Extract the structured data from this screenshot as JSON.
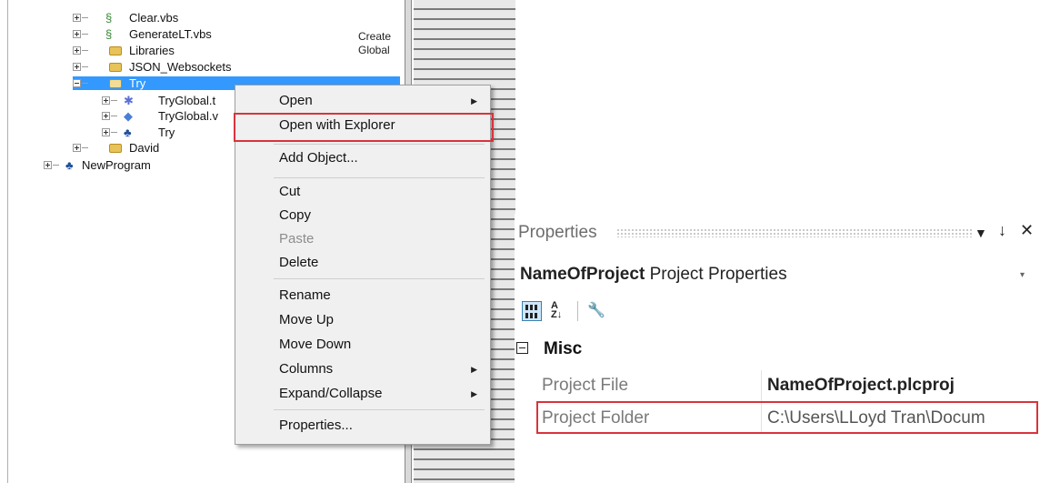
{
  "tree": {
    "items": [
      {
        "label": "Clear.vbs",
        "icon": "script-icon"
      },
      {
        "label": "GenerateLT.vbs",
        "icon": "script-icon"
      },
      {
        "label": "Libraries",
        "icon": "folder-icon"
      },
      {
        "label": "JSON_Websockets",
        "icon": "folder-icon"
      },
      {
        "label": "Try",
        "icon": "folder-icon"
      },
      {
        "label": "TryGlobal.t",
        "icon": "global-tag-icon"
      },
      {
        "label": "TryGlobal.v",
        "icon": "global-script-icon"
      },
      {
        "label": "Try",
        "icon": "program-icon"
      },
      {
        "label": "David",
        "icon": "folder-icon"
      },
      {
        "label": "NewProgram",
        "icon": "program-icon"
      }
    ],
    "descriptions": [
      "Create",
      "Global"
    ]
  },
  "context_menu": {
    "items": [
      {
        "label": "Open",
        "submenu": true
      },
      {
        "label": "Open with Explorer"
      },
      {
        "label": "Add Object..."
      },
      {
        "label": "Cut"
      },
      {
        "label": "Copy"
      },
      {
        "label": "Paste",
        "disabled": true
      },
      {
        "label": "Delete"
      },
      {
        "label": "Rename"
      },
      {
        "label": "Move Up"
      },
      {
        "label": "Move Down"
      },
      {
        "label": "Columns",
        "submenu": true
      },
      {
        "label": "Expand/Collapse",
        "submenu": true
      },
      {
        "label": "Properties..."
      }
    ],
    "highlight_color": "#d8343c"
  },
  "properties": {
    "title": "Properties",
    "pin_glyph": "↓",
    "dropdown_glyph": "▼",
    "close_glyph": "✕",
    "subject_name": "NameOfProject",
    "subject_type": "Project Properties",
    "category": "Misc",
    "rows": [
      {
        "name": "Project File",
        "value": "NameOfProject.plcproj"
      },
      {
        "name": "Project Folder",
        "value": "C:\\Users\\LLoyd Tran\\Docum"
      }
    ]
  }
}
